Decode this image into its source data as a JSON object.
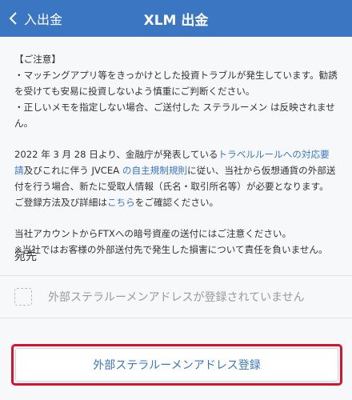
{
  "header": {
    "back_label": "入出金",
    "title": "XLM 出金"
  },
  "notice": {
    "heading": "【ご注意】",
    "bullet1": "・マッチングアプリ等をきっかけとした投資トラブルが発生しています。勧誘を受けても安易に投資しないよう慎重にご判断ください。",
    "bullet2": "・正しいメモを指定しない場合、ご送付した ステラルーメン は反映されません。",
    "p2_part1": "2022 年 3 月 28 日より、金融庁が発表している",
    "p2_link1": "トラベルルールへの対応要請",
    "p2_part2": "及びこれに伴う JVCEA ",
    "p2_link2": "の自主規制規則",
    "p2_part3": "に従い、当社から仮想通貨の外部送付を行う場合、新たに受取人情報（氏名・取引所名等）が必要となります。ご登録方法及び詳細は",
    "p2_link3": "こちら",
    "p2_part4": "をご確認ください。",
    "p3_line1": "当社アカウントからFTXへの暗号資産の送付にはご注意ください。",
    "p3_line2": "※当社ではお客様の外部送付先で発生した損害について責任を負いません。"
  },
  "destination": {
    "label": "宛先",
    "empty_text": "外部ステラルーメンアドレスが登録されていません"
  },
  "register_button": "外部ステラルーメンアドレス登録",
  "colors": {
    "header": "#3a76c2",
    "link": "#3a76c2",
    "highlight_border": "#d9132b"
  },
  "icons": {
    "back": "chevron-left-icon",
    "checkbox": "empty-checkbox-icon"
  }
}
